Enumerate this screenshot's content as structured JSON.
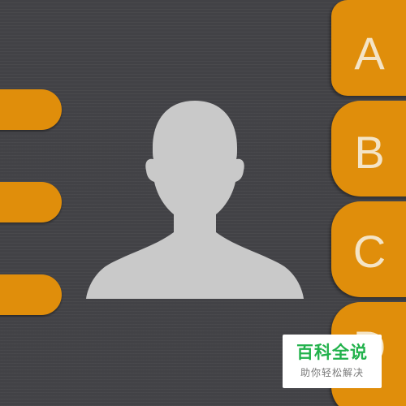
{
  "app_icon": {
    "name": "contacts-app-icon",
    "colors": {
      "background": "#424246",
      "accent": "#e08e0b",
      "tab_letter": "#f4e4c6",
      "avatar": "#c9c9c9"
    },
    "tabs": [
      {
        "letter": "A"
      },
      {
        "letter": "B"
      },
      {
        "letter": "C"
      },
      {
        "letter": "D"
      }
    ],
    "rings": 3,
    "avatar_icon": "person-silhouette-icon"
  },
  "watermark": {
    "title": "百科全说",
    "subtitle": "助你轻松解决",
    "color": "#22b24c"
  }
}
